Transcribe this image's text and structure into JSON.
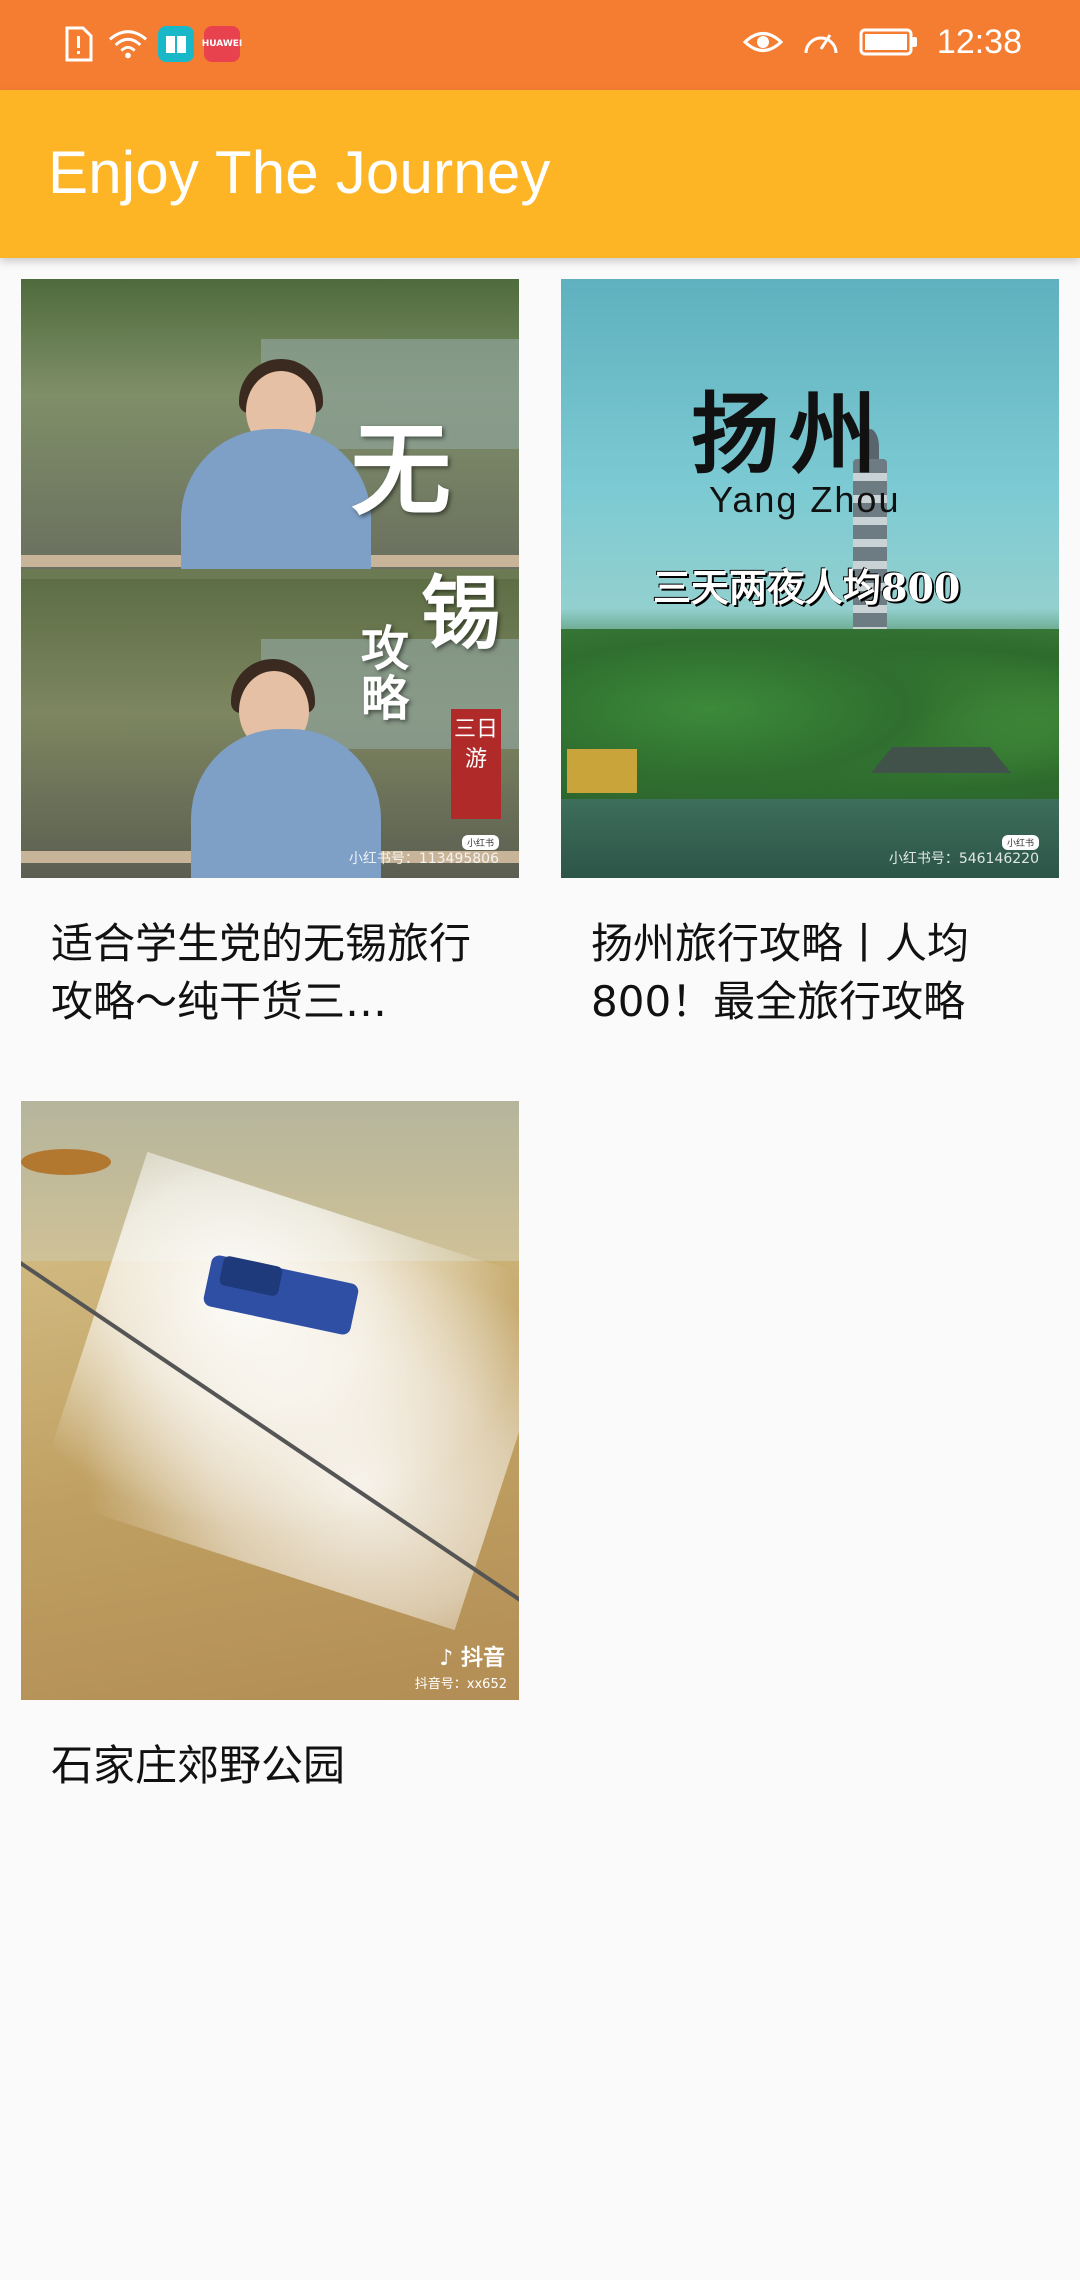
{
  "status_bar": {
    "time": "12:38",
    "left_icons": [
      "sim-alert-icon",
      "wifi-icon",
      "book-app-icon",
      "huawei-store-icon"
    ],
    "huawei_badge_text": "HUAWEI",
    "right_icons": [
      "eye-comfort-icon",
      "speed-icon",
      "battery-icon"
    ]
  },
  "appbar": {
    "title": "Enjoy The Journey"
  },
  "cards": [
    {
      "title": "适合学生党的无锡旅行攻略～纯干货三…",
      "image_text": {
        "calligraphy_1": "无",
        "calligraphy_2": "锡",
        "calligraphy_3": "攻",
        "calligraphy_4": "略",
        "seal": "三日游",
        "badge": "小红书",
        "watermark": "小红书号：113495806"
      }
    },
    {
      "title": "扬州旅行攻略丨人均800！最全旅行攻略",
      "image_text": {
        "big": "扬州",
        "latin": "Yang  Zhou",
        "caption": "三天两夜人均800",
        "badge": "小红书",
        "watermark": "小红书号：546146220"
      }
    },
    {
      "title": "石家庄郊野公园",
      "image_text": {
        "brand": "抖音",
        "watermark": "抖音号：xx652"
      }
    }
  ]
}
